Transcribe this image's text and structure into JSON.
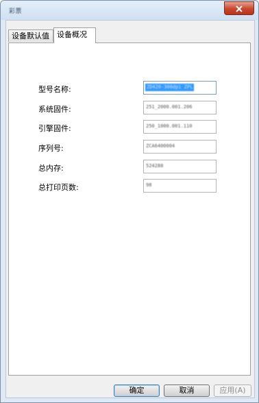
{
  "window": {
    "title": "彩票"
  },
  "tabs": [
    {
      "label": "设备默认值"
    },
    {
      "label": "设备概况"
    }
  ],
  "fields": [
    {
      "label": "型号名称:",
      "value": "ZD420-300dpi ZPL"
    },
    {
      "label": "系统固件:",
      "value": "251_2000.001.206"
    },
    {
      "label": "引擎固件:",
      "value": "250_1000.001.110"
    },
    {
      "label": "序列号:",
      "value": "ZCA6400004"
    },
    {
      "label": "总内存:",
      "value": "524288"
    },
    {
      "label": "总打印页数:",
      "value": "98"
    }
  ],
  "buttons": {
    "ok": "确定",
    "cancel": "取消",
    "apply": "应用(A)"
  }
}
